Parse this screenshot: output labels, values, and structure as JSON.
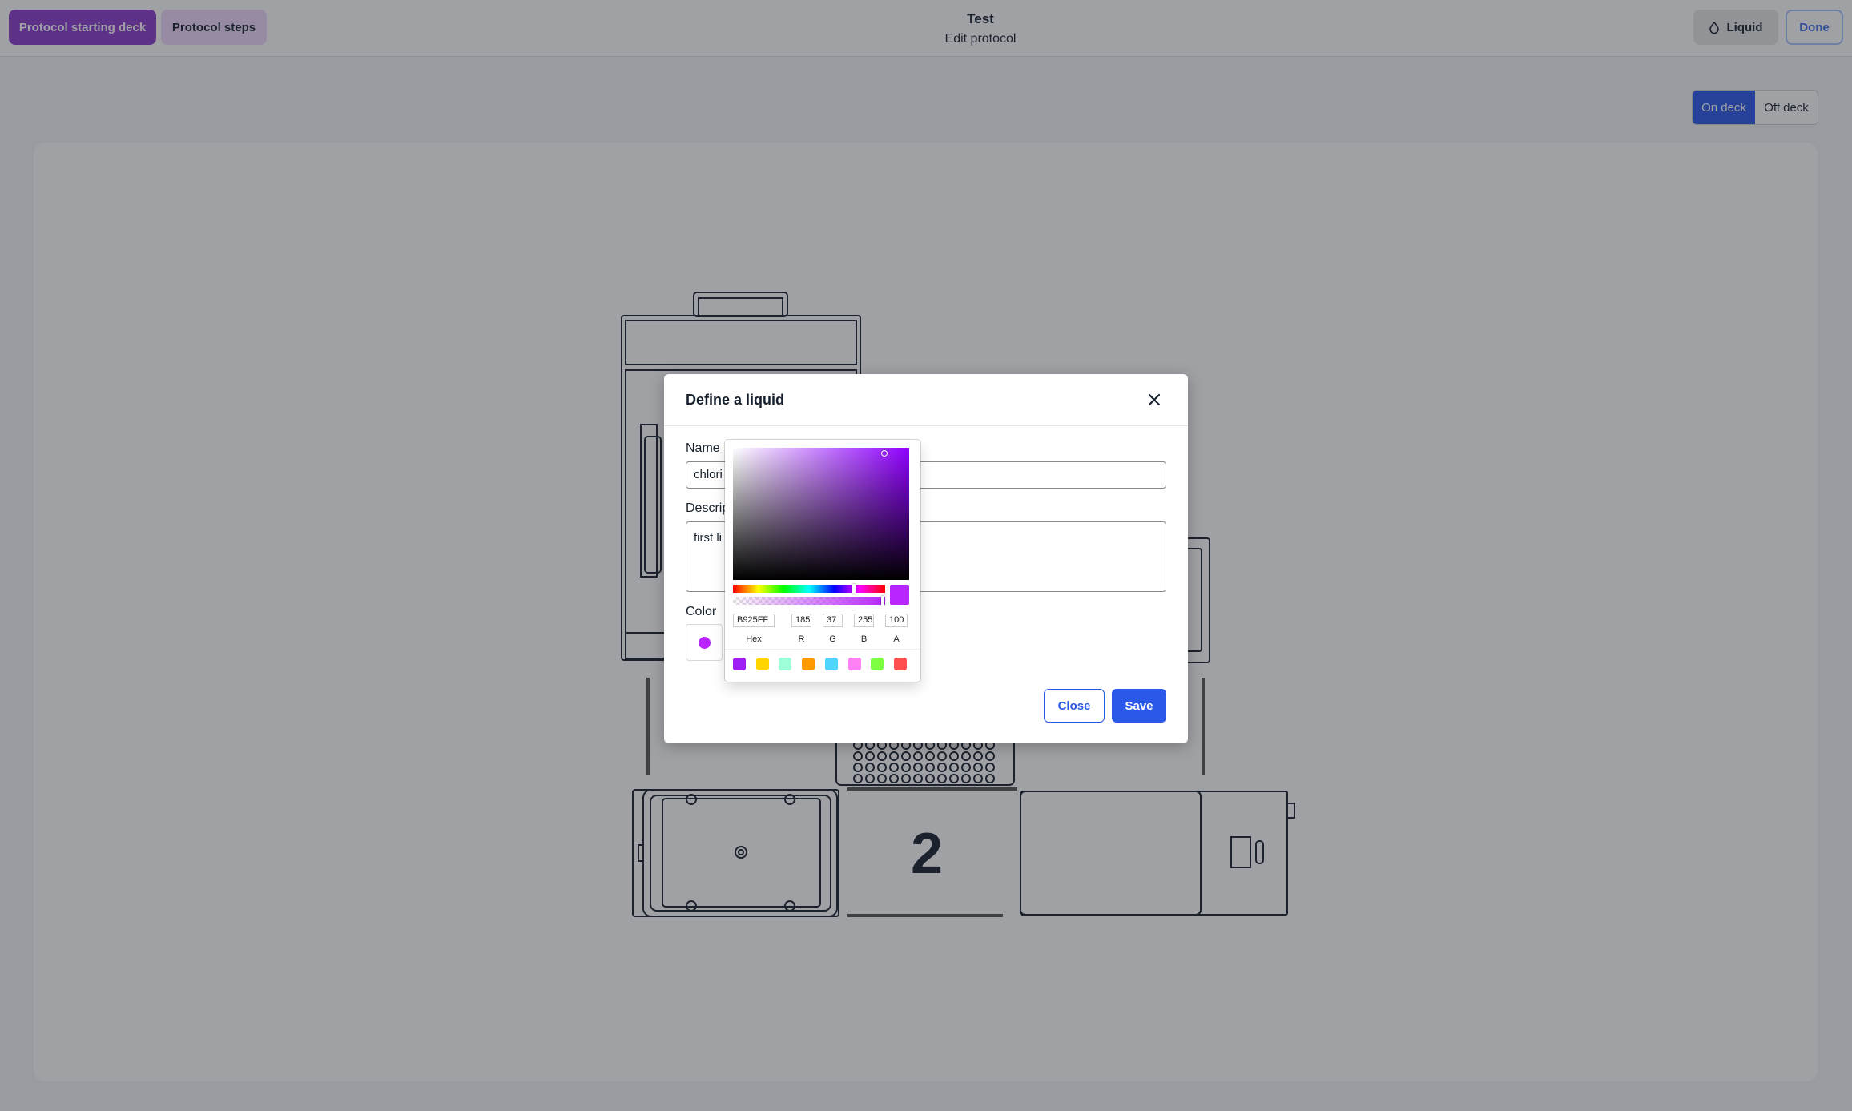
{
  "topbar": {
    "starting_deck_label": "Protocol starting deck",
    "steps_label": "Protocol steps",
    "protocol_name": "Test",
    "subtitle": "Edit protocol",
    "liquid_label": "Liquid",
    "done_label": "Done"
  },
  "deck_toggle": {
    "on_label": "On deck",
    "off_label": "Off deck"
  },
  "deck": {
    "slot_number": "2"
  },
  "modal": {
    "title": "Define a liquid",
    "name_label": "Name",
    "name_value": "chlori",
    "description_label": "Descrip",
    "description_value": "first li",
    "color_label": "Color",
    "close_label": "Close",
    "save_label": "Save"
  },
  "picker": {
    "hex": "B925FF",
    "r": "185",
    "g": "37",
    "b": "255",
    "a": "100",
    "labels": {
      "hex": "Hex",
      "r": "R",
      "g": "G",
      "b": "B",
      "a": "A"
    },
    "presets": [
      "#9d1ff5",
      "#ffd600",
      "#9dffd8",
      "#ff9900",
      "#50d5ff",
      "#ff80f5",
      "#7eff42",
      "#ff4f4f"
    ]
  },
  "colors": {
    "accent": "#2a58e8",
    "brand_purple": "#8c3bce",
    "selected_liquid": "#b925ff"
  }
}
